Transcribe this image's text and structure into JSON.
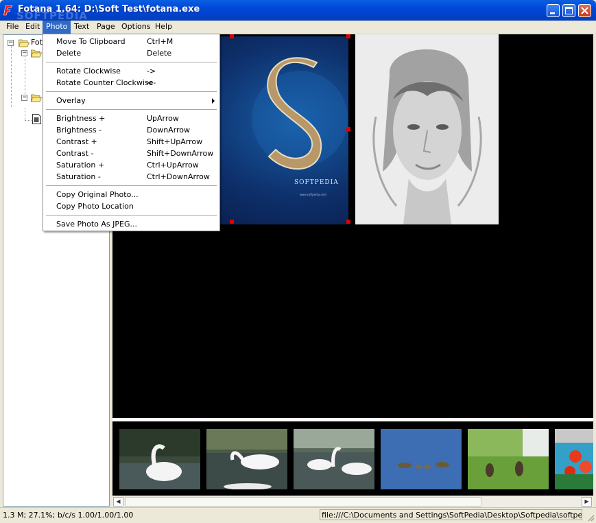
{
  "window": {
    "title": "Fotana 1.64: D:\\Soft Test\\fotana.exe",
    "watermark": "SOFTPEDIA",
    "colors": {
      "titlebar": "#0048d8",
      "menu_highlight": "#316ac5",
      "selection_handle": "#e00000",
      "viewer_bg": "#000000"
    }
  },
  "menubar": {
    "items": [
      "File",
      "Edit",
      "Photo",
      "Text",
      "Page",
      "Options",
      "Help"
    ],
    "active": "Photo"
  },
  "tree": {
    "root_label": "Fot"
  },
  "photo_menu": {
    "items": [
      {
        "label": "Move To Clipboard",
        "shortcut": "Ctrl+M"
      },
      {
        "label": "Delete",
        "shortcut": "Delete"
      },
      {
        "label": "Rotate Clockwise",
        "shortcut": "->"
      },
      {
        "label": "Rotate Counter Clockwise",
        "shortcut": "<-"
      },
      {
        "label": "Overlay",
        "shortcut": ""
      },
      {
        "label": "Brightness +",
        "shortcut": "UpArrow"
      },
      {
        "label": "Brightness -",
        "shortcut": "DownArrow"
      },
      {
        "label": "Contrast +",
        "shortcut": "Shift+UpArrow"
      },
      {
        "label": "Contrast -",
        "shortcut": "Shift+DownArrow"
      },
      {
        "label": "Saturation +",
        "shortcut": "Ctrl+UpArrow"
      },
      {
        "label": "Saturation -",
        "shortcut": "Ctrl+DownArrow"
      },
      {
        "label": "Copy Original Photo...",
        "shortcut": ""
      },
      {
        "label": "Copy Photo Location",
        "shortcut": ""
      },
      {
        "label": "Save Photo As JPEG...",
        "shortcut": ""
      }
    ]
  },
  "viewer": {
    "photo1_caption": "SOFTPEDIA",
    "photo1_subcaption": "www.softpedia.com"
  },
  "status": {
    "left": "1.3 M; 27.1%; b/c/s 1.00/1.00/1.00",
    "right": "file:///C:\\Documents and Settings\\SoftPedia\\Desktop\\Softpedia\\softpedia_wallpa"
  }
}
